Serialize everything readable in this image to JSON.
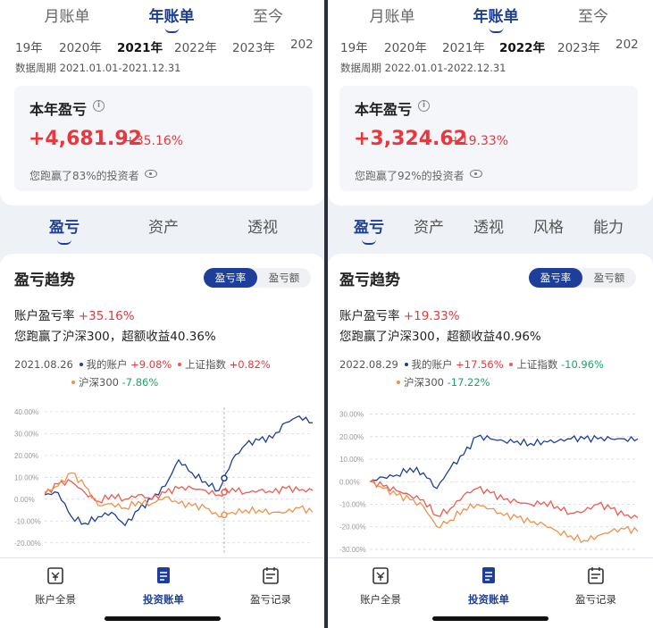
{
  "colors": {
    "accent": "#1d3f9a",
    "red": "#e8373d",
    "green": "#1aa36a",
    "account_line": "#1d3f9a",
    "sh_line": "#ee5b4f",
    "hs300_line": "#f2904a"
  },
  "screens": [
    {
      "period_tabs": [
        "月账单",
        "年账单",
        "至今"
      ],
      "active_period": "年账单",
      "years": [
        "19年",
        "2020年",
        "2021年",
        "2022年",
        "2023年",
        "202"
      ],
      "active_year": "2021年",
      "period_range": "数据周期 2021.01.01-2021.12.31",
      "card": {
        "title": "本年盈亏",
        "amount": "+4,681.92",
        "pct": "+35.16%",
        "beat_text": "您跑赢了83%的投资者"
      },
      "sub_tabs": [
        "盈亏",
        "资产",
        "透视"
      ],
      "trend": {
        "title": "盈亏趋势",
        "toggle_on": "盈亏率",
        "toggle_off": "盈亏额",
        "rate_label": "账户盈亏率",
        "rate_value": "+35.16%",
        "beat_text": "您跑赢了沪深300，超额收益40.36%",
        "legend_date": "2021.08.26",
        "my_account_label": "我的账户",
        "my_account_value": "+9.08%",
        "sh_label": "上证指数",
        "sh_value": "+0.82%",
        "hs300_label": "沪深300",
        "hs300_value": "-7.86%"
      },
      "chart_data": {
        "type": "line",
        "y_ticks": [
          "40.00%",
          "30.00%",
          "20.00%",
          "10.00%",
          "0.00%",
          "-10.00%",
          "-20.00%"
        ],
        "ylim": [
          -25,
          42
        ],
        "x": [
          0,
          5,
          10,
          15,
          20,
          25,
          30,
          35,
          40,
          45,
          50,
          55,
          60,
          65,
          70,
          75,
          80,
          85,
          90,
          95,
          100
        ],
        "crosshair_x": 67,
        "series": [
          {
            "name": "我的账户",
            "values": [
              2,
              3,
              -8,
              -11,
              -8,
              -6,
              -12,
              -5,
              0,
              6,
              18,
              12,
              8,
              4,
              18,
              25,
              27,
              28,
              35,
              38,
              35
            ]
          },
          {
            "name": "上证指数",
            "values": [
              2,
              7,
              8,
              3,
              -1,
              2,
              0,
              2,
              0,
              3,
              5,
              5,
              4,
              2,
              5,
              3,
              4,
              3,
              5,
              4,
              4
            ]
          },
          {
            "name": "沪深300",
            "values": [
              3,
              6,
              12,
              6,
              -3,
              -2,
              -4,
              -1,
              -2,
              1,
              -2,
              -3,
              -4,
              -8,
              -6,
              -5,
              -5,
              -6,
              -6,
              -4,
              -6
            ]
          }
        ]
      },
      "bottom_nav": [
        "账户全景",
        "投资账单",
        "盈亏记录"
      ],
      "active_nav": "投资账单"
    },
    {
      "period_tabs": [
        "月账单",
        "年账单",
        "至今"
      ],
      "active_period": "年账单",
      "years": [
        "19年",
        "2020年",
        "2021年",
        "2022年",
        "2023年",
        "202"
      ],
      "active_year": "2022年",
      "period_range": "数据周期 2022.01.01-2022.12.31",
      "card": {
        "title": "本年盈亏",
        "amount": "+3,324.62",
        "pct": "+19.33%",
        "beat_text": "您跑赢了92%的投资者"
      },
      "sub_tabs": [
        "盈亏",
        "资产",
        "透视",
        "风格",
        "能力"
      ],
      "trend": {
        "title": "盈亏趋势",
        "toggle_on": "盈亏率",
        "toggle_off": "盈亏额",
        "rate_label": "账户盈亏率",
        "rate_value": "+19.33%",
        "beat_text": "您跑赢了沪深300，超额收益40.96%",
        "legend_date": "2022.08.29",
        "my_account_label": "我的账户",
        "my_account_value": "+17.56%",
        "sh_label": "上证指数",
        "sh_value": "-10.96%",
        "hs300_label": "沪深300",
        "hs300_value": "-17.22%"
      },
      "chart_data": {
        "type": "line",
        "y_ticks": [
          "30.00%",
          "20.00%",
          "10.00%",
          "0.00%",
          "-10.00%",
          "-20.00%",
          "-30.00%"
        ],
        "ylim": [
          -32,
          33
        ],
        "x": [
          0,
          5,
          10,
          15,
          20,
          25,
          30,
          35,
          40,
          45,
          50,
          55,
          60,
          65,
          70,
          75,
          80,
          85,
          90,
          95,
          100
        ],
        "crosshair_x": null,
        "series": [
          {
            "name": "我的账户",
            "values": [
              0,
              2,
              3,
              6,
              4,
              -3,
              6,
              12,
              20,
              19,
              18,
              18,
              17,
              18,
              18,
              19,
              19,
              19,
              19,
              19,
              19
            ]
          },
          {
            "name": "上证指数",
            "values": [
              0,
              -2,
              -4,
              -6,
              -8,
              -15,
              -12,
              -6,
              -3,
              -5,
              -8,
              -9,
              -10,
              -9,
              -11,
              -14,
              -13,
              -10,
              -12,
              -15,
              -16
            ]
          },
          {
            "name": "沪深300",
            "values": [
              0,
              -3,
              -6,
              -8,
              -11,
              -20,
              -17,
              -12,
              -10,
              -12,
              -15,
              -16,
              -18,
              -19,
              -22,
              -24,
              -26,
              -24,
              -22,
              -21,
              -22
            ]
          }
        ]
      },
      "bottom_nav": [
        "账户全景",
        "投资账单",
        "盈亏记录"
      ],
      "active_nav": "投资账单"
    }
  ]
}
